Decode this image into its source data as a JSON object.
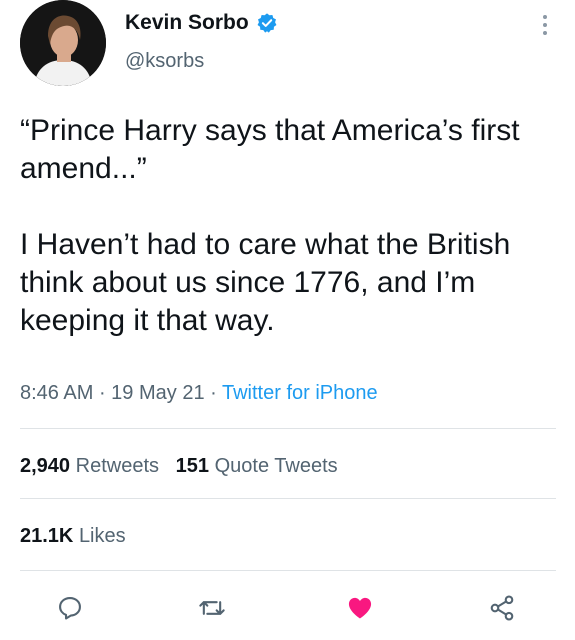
{
  "author": {
    "display_name": "Kevin Sorbo",
    "handle": "@ksorbs",
    "verified_icon": "verified-badge-icon"
  },
  "tweet": {
    "paragraph_1": "“Prince Harry says that America’s first amend...”",
    "paragraph_2": "I Haven’t had to care what the British think about us since 1776, and I’m keeping it that way."
  },
  "meta": {
    "time": "8:46 AM",
    "separator": " · ",
    "date": "19 May 21",
    "source": "Twitter for iPhone"
  },
  "stats": {
    "retweets_count": "2,940",
    "retweets_label": "Retweets",
    "quotes_count": "151",
    "quotes_label": "Quote Tweets",
    "likes_count": "21.1K",
    "likes_label": "Likes"
  },
  "actions": {
    "reply_icon": "reply-icon",
    "retweet_icon": "retweet-icon",
    "like_icon": "heart-icon",
    "share_icon": "share-icon"
  },
  "colors": {
    "accent": "#1d9bf0",
    "like": "#f91880",
    "secondary_text": "#536471"
  }
}
